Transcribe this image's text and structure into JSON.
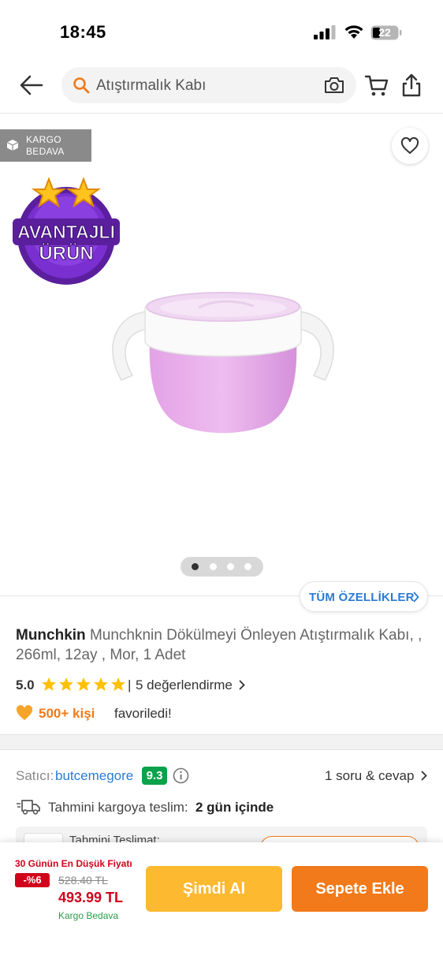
{
  "status_bar": {
    "time": "18:45",
    "battery": "22"
  },
  "header": {
    "search_text": "Atıştırmalık Kabı"
  },
  "gallery": {
    "cargo_line1": "KARGO",
    "cargo_line2": "BEDAVA",
    "badge_line1": "AVANTAJLI",
    "badge_line2": "ÜRÜN",
    "image_count": 4,
    "active_image_index": 0
  },
  "all_features_label": "TÜM ÖZELLİKLER",
  "product": {
    "brand": "Munchkin",
    "name": "Munchknin Dökülmeyi Önleyen Atıştırmalık Kabı, , 266ml, 12ay , Mor, 1 Adet",
    "rating_score": "5.0",
    "rating_stars": 5,
    "rating_separator": "|",
    "rating_count": "5 değerlendirme",
    "favorites_count": "500+ kişi",
    "favorites_text": "favoriledi!"
  },
  "seller": {
    "label": "Satıcı:",
    "name": "butcemegore",
    "score": "9.3",
    "qa_label": "1 soru & cevap"
  },
  "delivery": {
    "label": "Tahmini kargoya teslim:",
    "value": "2 gün içinde",
    "estimate_label": "Tahmini Teslimat:"
  },
  "bottom_bar": {
    "lowest_label": "30 Günün En Düşük Fiyatı",
    "discount": "-%6",
    "old_price": "528.40 TL",
    "price": "493.99 TL",
    "free_shipping": "Kargo Bedava",
    "buy_now": "Şimdi Al",
    "add_to_cart": "Sepete Ekle"
  },
  "colors": {
    "accent_orange": "#f27a1a",
    "buy_yellow": "#fdb930",
    "link_blue": "#2a7bd6",
    "price_red": "#d0021b",
    "seller_green": "#0aa24a",
    "star_yellow": "#ffc000"
  }
}
